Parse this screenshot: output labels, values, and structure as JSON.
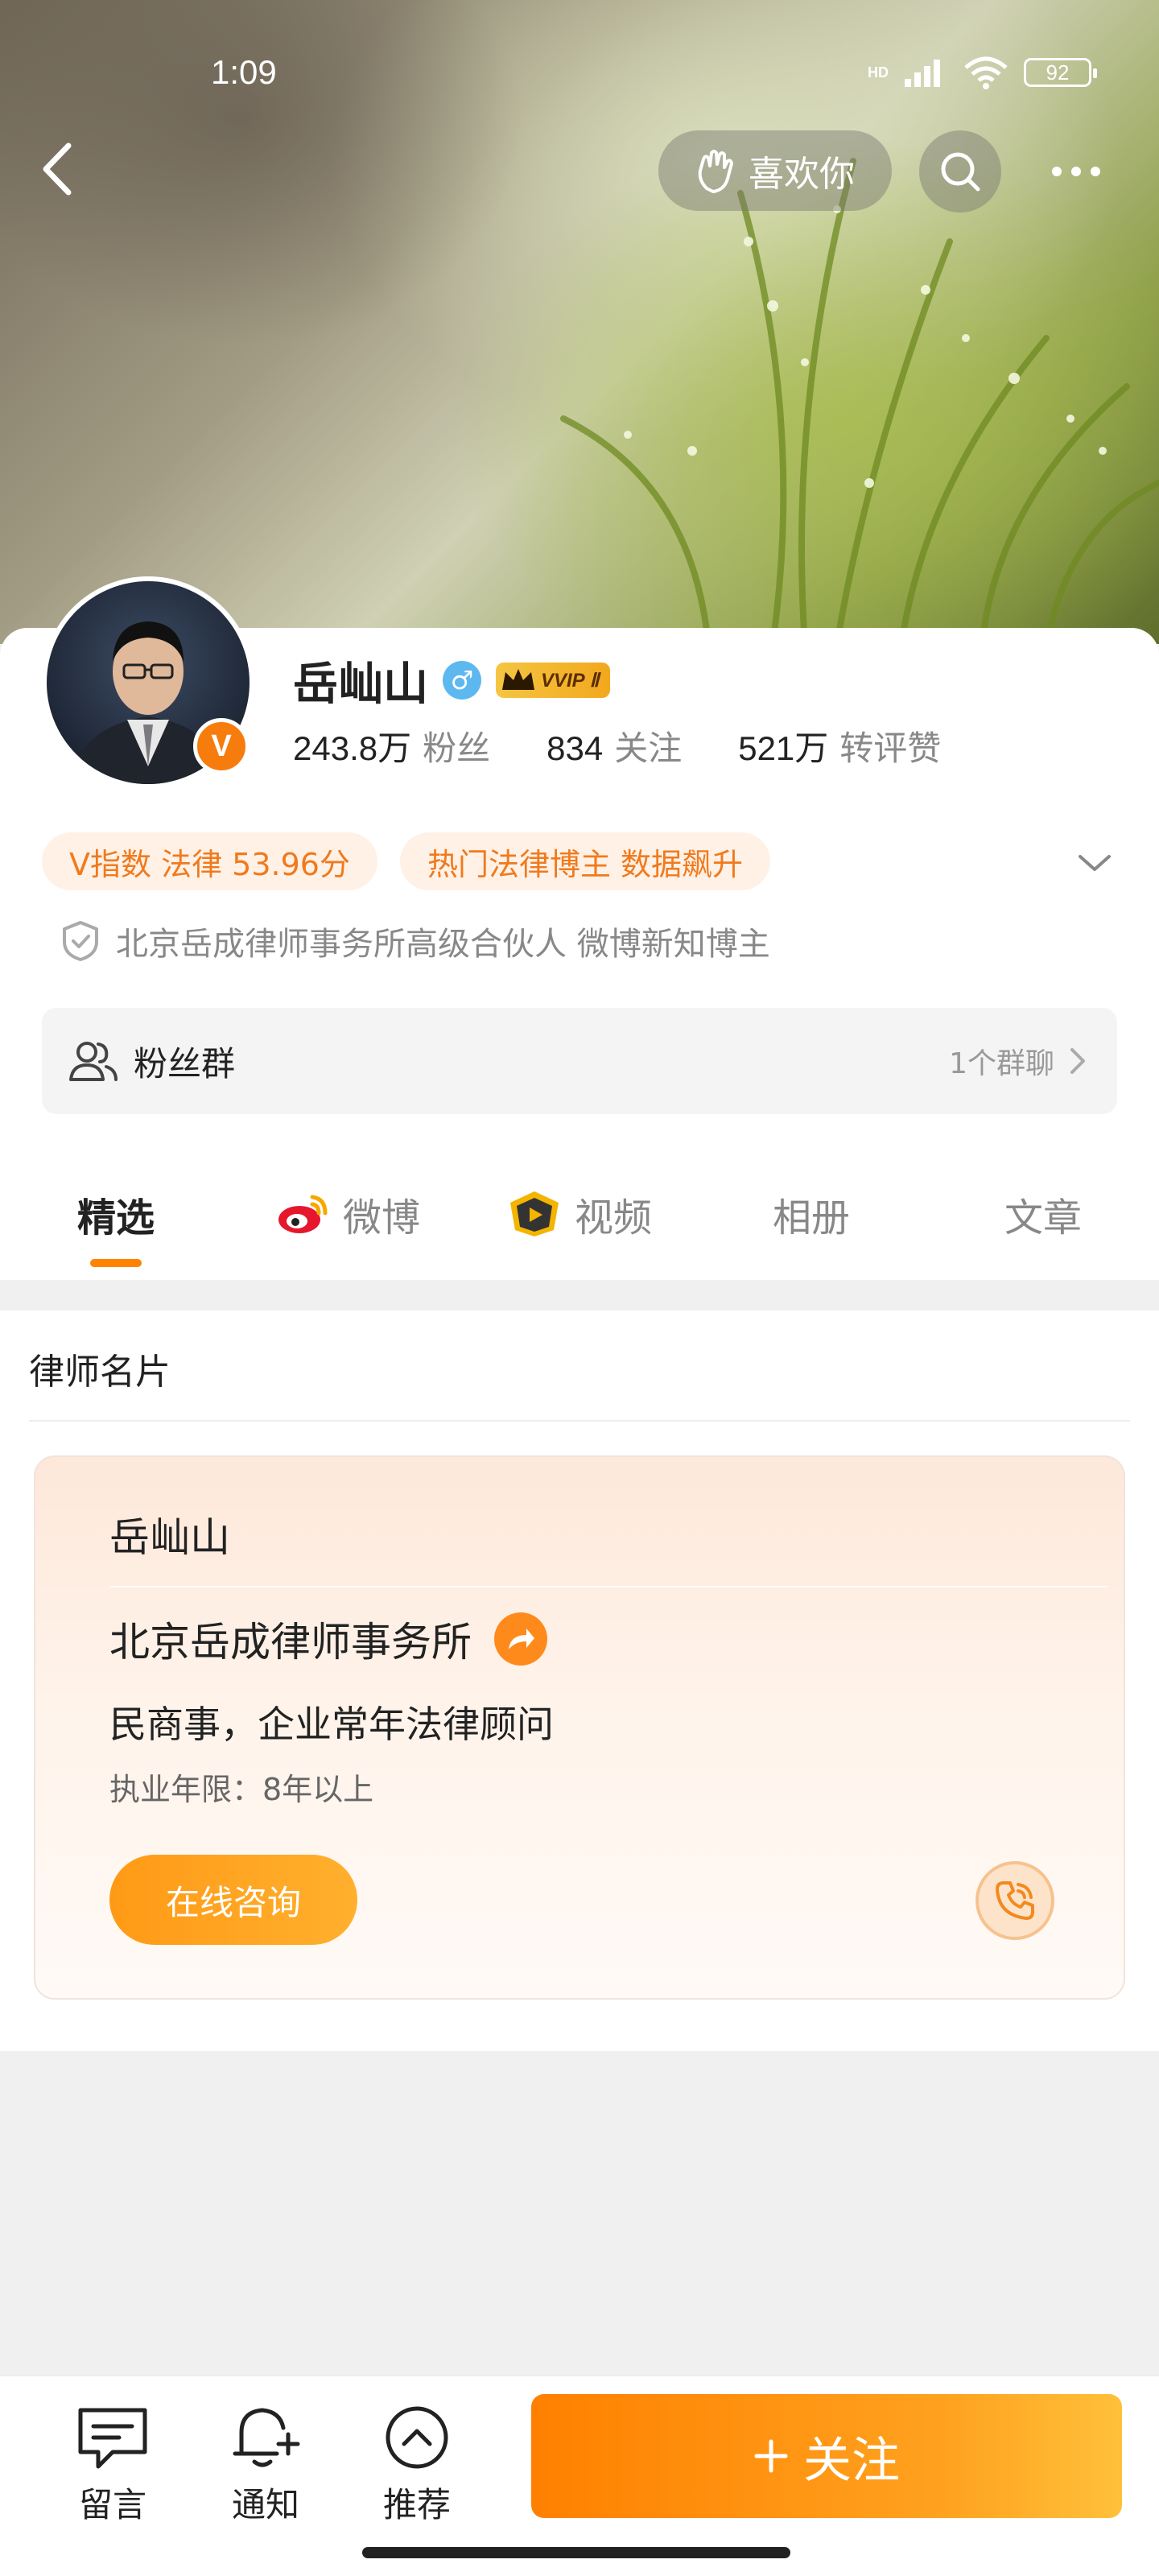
{
  "status_bar": {
    "time": "1:09",
    "battery": "92",
    "network_label": "HD"
  },
  "header": {
    "like_label": "喜欢你"
  },
  "profile": {
    "name": "岳屾山",
    "vip_label": "VVIP Ⅱ",
    "stats": [
      {
        "value": "243.8万",
        "label": "粉丝"
      },
      {
        "value": "834",
        "label": "关注"
      },
      {
        "value": "521万",
        "label": "转评赞"
      }
    ],
    "tags": [
      "V指数 法律 53.96分",
      "热门法律博主 数据飙升"
    ],
    "verification": "北京岳成律师事务所高级合伙人 微博新知博主",
    "fans_group": {
      "label": "粉丝群",
      "count": "1个群聊"
    }
  },
  "tabs": [
    {
      "label": "精选",
      "icon": "",
      "active": true
    },
    {
      "label": "微博",
      "icon": "weibo-icon",
      "active": false
    },
    {
      "label": "视频",
      "icon": "video-icon",
      "active": false
    },
    {
      "label": "相册",
      "icon": "",
      "active": false
    },
    {
      "label": "文章",
      "icon": "",
      "active": false
    }
  ],
  "lawyer_section": {
    "title": "律师名片",
    "name": "岳屾山",
    "firm": "北京岳成律师事务所",
    "field": "民商事，企业常年法律顾问",
    "years": "执业年限：8年以上",
    "consult_label": "在线咨询"
  },
  "bottom_bar": {
    "items": [
      {
        "label": "留言",
        "icon": "message-icon"
      },
      {
        "label": "通知",
        "icon": "bell-plus-icon"
      },
      {
        "label": "推荐",
        "icon": "chevron-up-circle-icon"
      }
    ],
    "follow_label": "关注"
  },
  "colors": {
    "accent": "#ff8200",
    "tag_bg": "#fff1e6",
    "tag_text": "#f07a1d"
  }
}
